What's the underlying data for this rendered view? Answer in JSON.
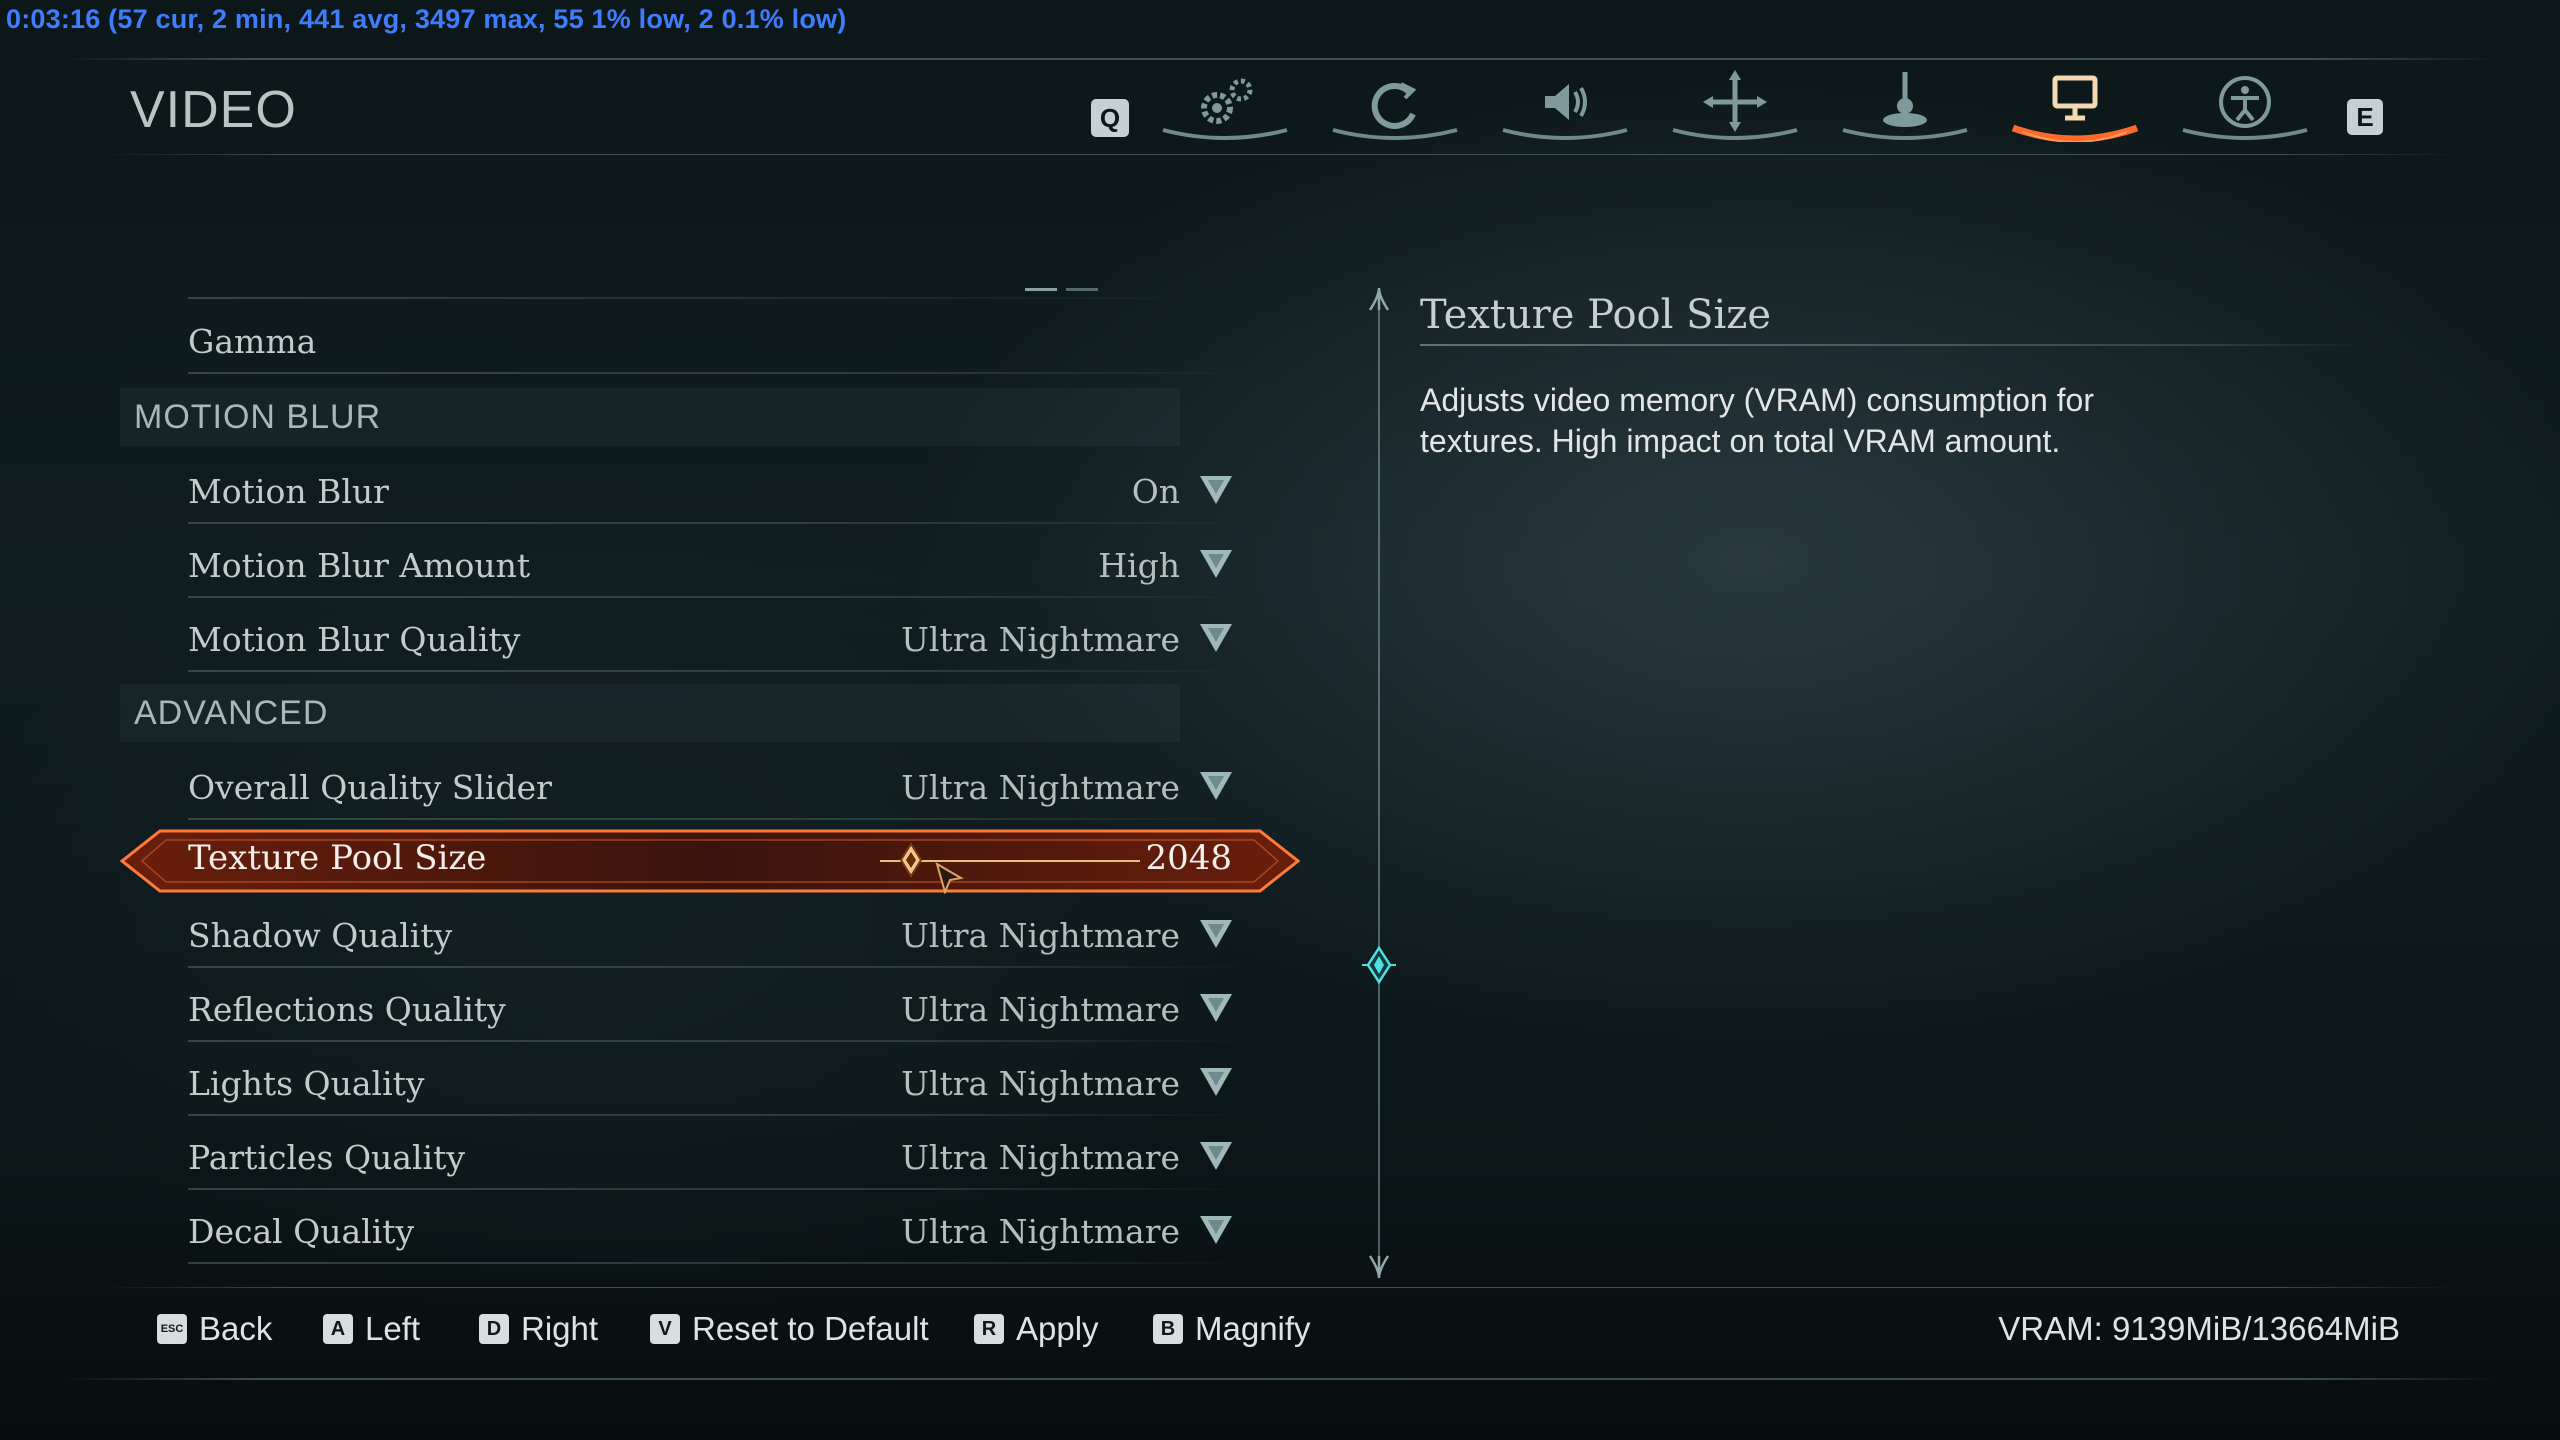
{
  "overlay": {
    "fps_text": "0:03:16 (57 cur, 2 min, 441 avg, 3497 max, 55 1% low, 2 0.1% low)"
  },
  "header": {
    "title": "VIDEO",
    "prev_key": "Q",
    "next_key": "E",
    "tabs": [
      {
        "icon": "gears-icon",
        "active": false
      },
      {
        "icon": "swirl-icon",
        "active": false
      },
      {
        "icon": "speaker-icon",
        "active": false
      },
      {
        "icon": "crosshair-icon",
        "active": false
      },
      {
        "icon": "joystick-icon",
        "active": false
      },
      {
        "icon": "monitor-icon",
        "active": true
      },
      {
        "icon": "accessibility-icon",
        "active": false
      }
    ],
    "active_color": "#ff6a2a"
  },
  "settings": {
    "gamma_label": "Gamma",
    "motion_blur_header": "MOTION BLUR",
    "motion_blur": {
      "label": "Motion Blur",
      "value": "On"
    },
    "motion_blur_amount": {
      "label": "Motion Blur Amount",
      "value": "High"
    },
    "motion_blur_quality": {
      "label": "Motion Blur Quality",
      "value": "Ultra Nightmare"
    },
    "advanced_header": "ADVANCED",
    "overall_quality": {
      "label": "Overall Quality Slider",
      "value": "Ultra Nightmare"
    },
    "texture_pool": {
      "label": "Texture Pool Size",
      "value": "2048",
      "slider_fraction": 0.12
    },
    "shadow_quality": {
      "label": "Shadow Quality",
      "value": "Ultra Nightmare"
    },
    "reflections_quality": {
      "label": "Reflections Quality",
      "value": "Ultra Nightmare"
    },
    "lights_quality": {
      "label": "Lights Quality",
      "value": "Ultra Nightmare"
    },
    "particles_quality": {
      "label": "Particles Quality",
      "value": "Ultra Nightmare"
    },
    "decal_quality": {
      "label": "Decal Quality",
      "value": "Ultra Nightmare"
    }
  },
  "description": {
    "title": "Texture Pool Size",
    "text": "Adjusts video memory (VRAM) consumption for textures. High impact on total VRAM amount."
  },
  "footer": {
    "back": {
      "key": "ESC",
      "label": "Back"
    },
    "left": {
      "key": "A",
      "label": "Left"
    },
    "right": {
      "key": "D",
      "label": "Right"
    },
    "reset": {
      "key": "V",
      "label": "Reset to Default"
    },
    "apply": {
      "key": "R",
      "label": "Apply"
    },
    "magnify": {
      "key": "B",
      "label": "Magnify"
    },
    "vram": "VRAM: 9139MiB/13664MiB"
  }
}
